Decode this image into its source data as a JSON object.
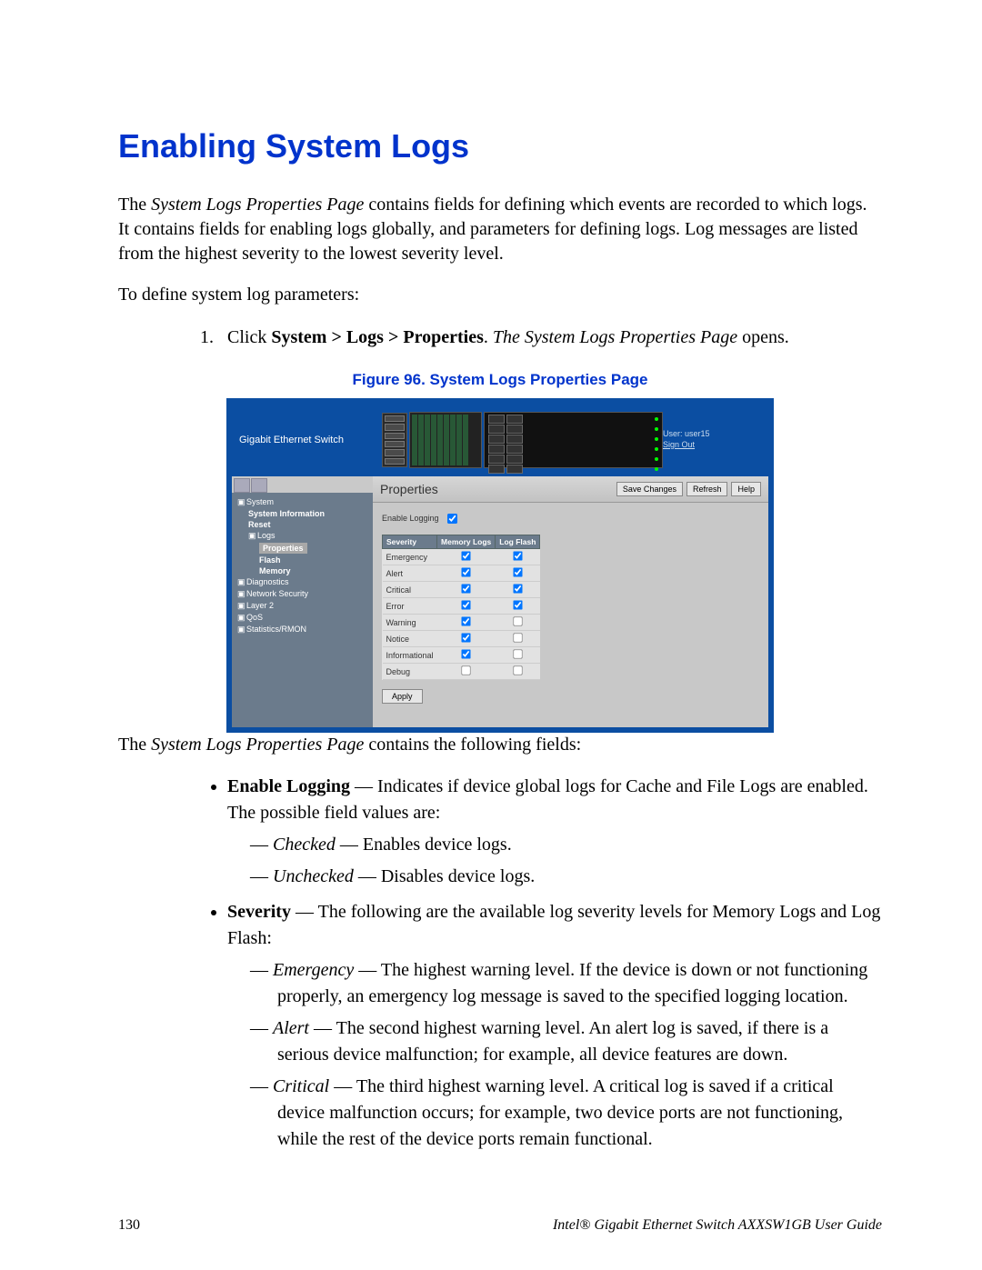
{
  "heading": "Enabling System Logs",
  "intro_html": "The <i>System Logs Properties Page</i> contains fields for defining which events are recorded to which logs. It contains fields for enabling logs globally, and parameters for defining logs. Log messages are listed from the highest severity to the lowest severity level.",
  "define_line": "To define system log parameters:",
  "step1_html": "Click <b>System > Logs > Properties</b>. <i>The System Logs Properties Page</i> opens.",
  "figure_caption": "Figure 96. System Logs Properties Page",
  "screenshot": {
    "brand": "Gigabit Ethernet Switch",
    "user_label": "User: user15",
    "signout": "Sign Out",
    "sidebar": [
      {
        "label": "System",
        "indent": 0,
        "icon": "▣"
      },
      {
        "label": "System Information",
        "indent": 1,
        "bold": true
      },
      {
        "label": "Reset",
        "indent": 1,
        "bold": true
      },
      {
        "label": "Logs",
        "indent": 1,
        "icon": "▣"
      },
      {
        "label": "Properties",
        "indent": 2,
        "selected": true
      },
      {
        "label": "Flash",
        "indent": 2,
        "bold": true
      },
      {
        "label": "Memory",
        "indent": 2,
        "bold": true
      },
      {
        "label": "Diagnostics",
        "indent": 0,
        "icon": "▣"
      },
      {
        "label": "Network Security",
        "indent": 0,
        "icon": "▣"
      },
      {
        "label": "Layer 2",
        "indent": 0,
        "icon": "▣"
      },
      {
        "label": "QoS",
        "indent": 0,
        "icon": "▣"
      },
      {
        "label": "Statistics/RMON",
        "indent": 0,
        "icon": "▣"
      }
    ],
    "panel_title": "Properties",
    "buttons": {
      "save": "Save Changes",
      "refresh": "Refresh",
      "help": "Help"
    },
    "enable_logging_label": "Enable Logging",
    "enable_logging_checked": true,
    "sev_headers": [
      "Severity",
      "Memory Logs",
      "Log Flash"
    ],
    "sev_rows": [
      {
        "name": "Emergency",
        "mem": true,
        "flash": true
      },
      {
        "name": "Alert",
        "mem": true,
        "flash": true
      },
      {
        "name": "Critical",
        "mem": true,
        "flash": true
      },
      {
        "name": "Error",
        "mem": true,
        "flash": true
      },
      {
        "name": "Warning",
        "mem": true,
        "flash": false
      },
      {
        "name": "Notice",
        "mem": true,
        "flash": false
      },
      {
        "name": "Informational",
        "mem": true,
        "flash": false
      },
      {
        "name": "Debug",
        "mem": false,
        "flash": false
      }
    ],
    "apply": "Apply"
  },
  "after_fig_html": "The <i>System Logs Properties Page</i> contains the following fields:",
  "fields": [
    {
      "lead_html": "<b>Enable Logging</b> — Indicates if device global logs for Cache and File Logs are enabled. The possible field values are:",
      "subs": [
        "<i>Checked</i> — Enables device logs.",
        "<i>Unchecked</i> — Disables device logs."
      ]
    },
    {
      "lead_html": "<b>Severity</b> — The following are the available log severity levels for Memory Logs and Log Flash:",
      "subs": [
        "<i>Emergency</i> — The highest warning level. If the device is down or not functioning properly, an emergency log message is saved to the specified logging location.",
        "<i>Alert</i> — The second highest warning level. An alert log is saved, if there is a serious device malfunction; for example, all device features are down.",
        "<i>Critical</i> — The third highest warning level. A critical log is saved if a critical device malfunction occurs; for example, two device ports are not functioning, while the rest of the device ports remain functional."
      ]
    }
  ],
  "footer": {
    "page": "130",
    "guide": "Intel® Gigabit Ethernet Switch AXXSW1GB User Guide"
  }
}
